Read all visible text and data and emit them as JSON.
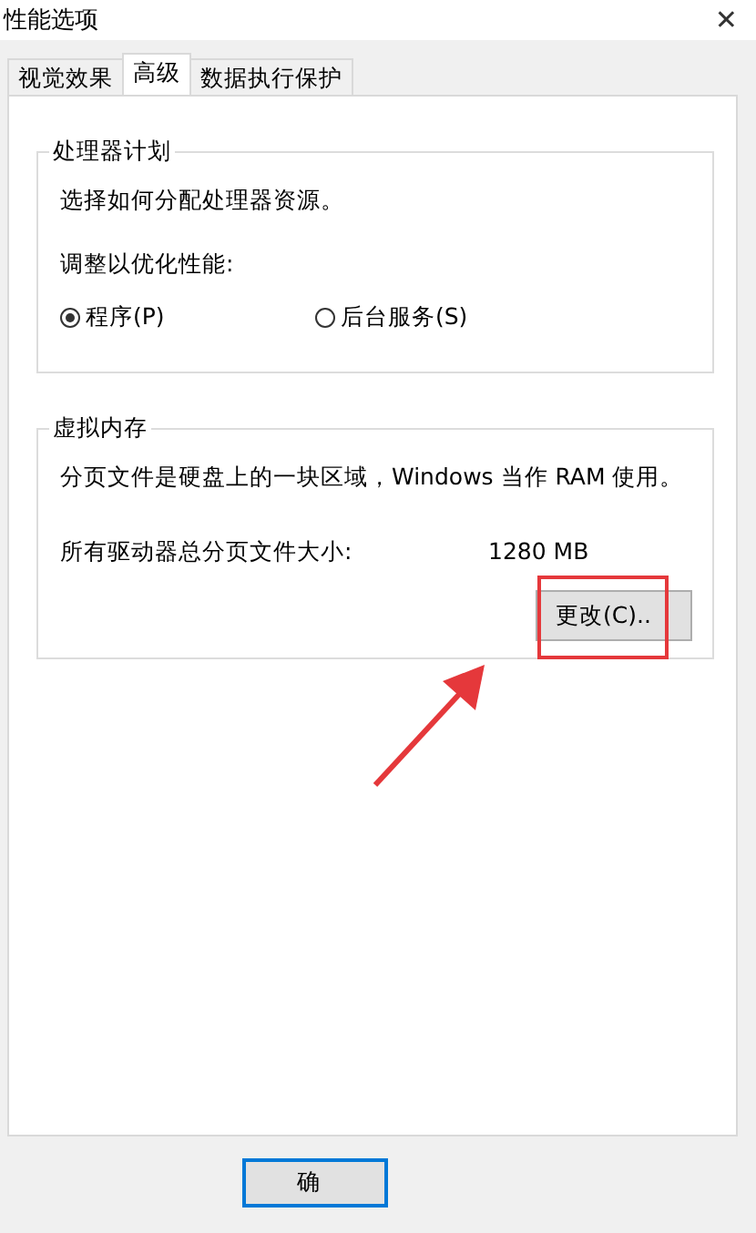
{
  "window": {
    "title": "性能选项",
    "close": "✕"
  },
  "tabs": [
    {
      "label": "视觉效果",
      "selected": false
    },
    {
      "label": "高级",
      "selected": true
    },
    {
      "label": "数据执行保护",
      "selected": false
    }
  ],
  "processor_group": {
    "title": "处理器计划",
    "description": "选择如何分配处理器资源。",
    "prompt": "调整以优化性能:",
    "options": [
      {
        "label": "程序(P)",
        "selected": true
      },
      {
        "label": "后台服务(S)",
        "selected": false
      }
    ]
  },
  "memory_group": {
    "title": "虚拟内存",
    "description": "分页文件是硬盘上的一块区域，Windows 当作 RAM 使用。",
    "size_label": "所有驱动器总分页文件大小:",
    "size_value": "1280 MB",
    "change_button": "更改(C).."
  },
  "annotation": {
    "highlight": true,
    "arrow": true
  },
  "buttons": [
    {
      "label": "确",
      "default": true
    }
  ]
}
